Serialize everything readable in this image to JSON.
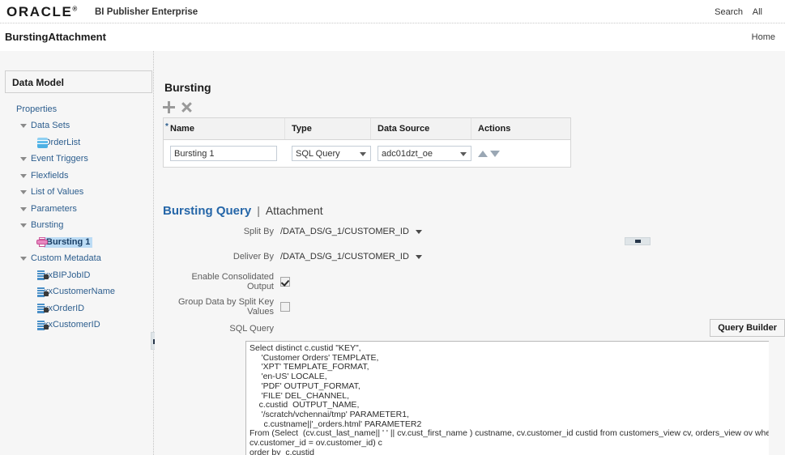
{
  "header": {
    "brand": "ORACLE",
    "brand_reg": "®",
    "product": "BI Publisher Enterprise",
    "search_label": "Search",
    "search_scope": "All"
  },
  "page": {
    "title": "BurstingAttachment",
    "home_label": "Home"
  },
  "sidebar": {
    "panel_title": "Data Model",
    "items": [
      {
        "label": "Properties",
        "level": 0,
        "twisty": "none",
        "icon": "none"
      },
      {
        "label": "Data Sets",
        "level": 1,
        "twisty": "open",
        "icon": "none"
      },
      {
        "label": "OrderList",
        "level": 2,
        "twisty": "none",
        "icon": "dataset-icon"
      },
      {
        "label": "Event Triggers",
        "level": 1,
        "twisty": "open",
        "icon": "none"
      },
      {
        "label": "Flexfields",
        "level": 1,
        "twisty": "open",
        "icon": "none"
      },
      {
        "label": "List of Values",
        "level": 1,
        "twisty": "open",
        "icon": "none"
      },
      {
        "label": "Parameters",
        "level": 1,
        "twisty": "open",
        "icon": "none"
      },
      {
        "label": "Bursting",
        "level": 1,
        "twisty": "open",
        "icon": "none"
      },
      {
        "label": "Bursting 1",
        "level": 2,
        "twisty": "none",
        "icon": "printer-icon",
        "selected": true
      },
      {
        "label": "Custom Metadata",
        "level": 1,
        "twisty": "open",
        "icon": "none"
      },
      {
        "label": "xxBIPJobID",
        "level": 2,
        "twisty": "none",
        "icon": "metadata-icon"
      },
      {
        "label": "xxCustomerName",
        "level": 2,
        "twisty": "none",
        "icon": "metadata-icon"
      },
      {
        "label": "xxOrderID",
        "level": 2,
        "twisty": "none",
        "icon": "metadata-icon"
      },
      {
        "label": "xxCustomerID",
        "level": 2,
        "twisty": "none",
        "icon": "metadata-icon"
      }
    ]
  },
  "bursting": {
    "section_title": "Bursting",
    "add_label": "+",
    "delete_label": "x",
    "columns": {
      "name": "Name",
      "type": "Type",
      "data_source": "Data Source",
      "actions": "Actions",
      "required_marker": "*"
    },
    "row": {
      "name": "Bursting 1",
      "type": "SQL Query",
      "data_source": "adc01dzt_oe"
    }
  },
  "query_panel": {
    "tab_active": "Bursting Query",
    "tab_separator": "|",
    "tab_inactive": "Attachment",
    "split_by_label": "Split By",
    "split_by_value": "/DATA_DS/G_1/CUSTOMER_ID",
    "deliver_by_label": "Deliver By",
    "deliver_by_value": "/DATA_DS/G_1/CUSTOMER_ID",
    "enable_consolidated_label": "Enable Consolidated Output",
    "enable_consolidated_checked": true,
    "group_data_label": "Group Data by Split Key Values",
    "group_data_checked": false,
    "sql_query_label": "SQL Query",
    "query_builder_label": "Query Builder",
    "sql_query_value": "Select distinct c.custid \"KEY\",\n     'Customer Orders' TEMPLATE,\n     'XPT' TEMPLATE_FORMAT,\n     'en-US' LOCALE,\n     'PDF' OUTPUT_FORMAT,\n     'FILE' DEL_CHANNEL,\n    c.custid  OUTPUT_NAME,\n     '/scratch/vchennai/tmp' PARAMETER1,\n      c.custname||'_orders.html' PARAMETER2\nFrom (Select  (cv.cust_last_name|| ' ' || cv.cust_first_name ) custname, cv.customer_id custid from customers_view cv, orders_view ov where\ncv.customer_id = ov.customer_id) c\norder by  c.custid"
  },
  "colors": {
    "accent": "#2566a8",
    "tree_link": "#2d5e8e",
    "selection": "#bcdcf5",
    "page_bg": "#f6f6f6"
  }
}
